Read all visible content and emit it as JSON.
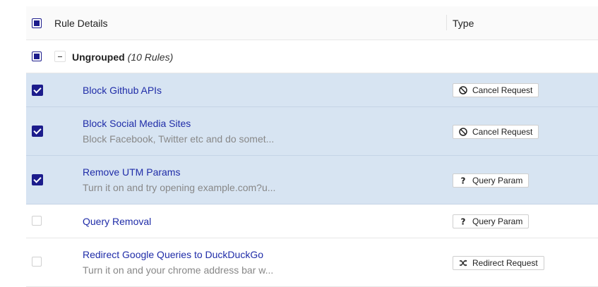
{
  "header": {
    "rule_details_label": "Rule Details",
    "type_label": "Type"
  },
  "group": {
    "name": "Ungrouped",
    "count_text": "(10 Rules)"
  },
  "rules": [
    {
      "name": "Block Github APIs",
      "description": "",
      "type": "Cancel Request",
      "type_icon": "block-icon",
      "selected": true
    },
    {
      "name": "Block Social Media Sites",
      "description": "Block Facebook, Twitter etc and do somet...",
      "type": "Cancel Request",
      "type_icon": "block-icon",
      "selected": true
    },
    {
      "name": "Remove UTM Params",
      "description": "Turn it on and try opening example.com?u...",
      "type": "Query Param",
      "type_icon": "question-icon",
      "selected": true
    },
    {
      "name": "Query Removal",
      "description": "",
      "type": "Query Param",
      "type_icon": "question-icon",
      "selected": false
    },
    {
      "name": "Redirect Google Queries to DuckDuckGo",
      "description": "Turn it on and your chrome address bar w...",
      "type": "Redirect Request",
      "type_icon": "shuffle-icon",
      "selected": false
    }
  ],
  "colors": {
    "link": "#1f2ca8",
    "selected_row": "#d7e4f2",
    "checkbox": "#1c1c8c"
  }
}
